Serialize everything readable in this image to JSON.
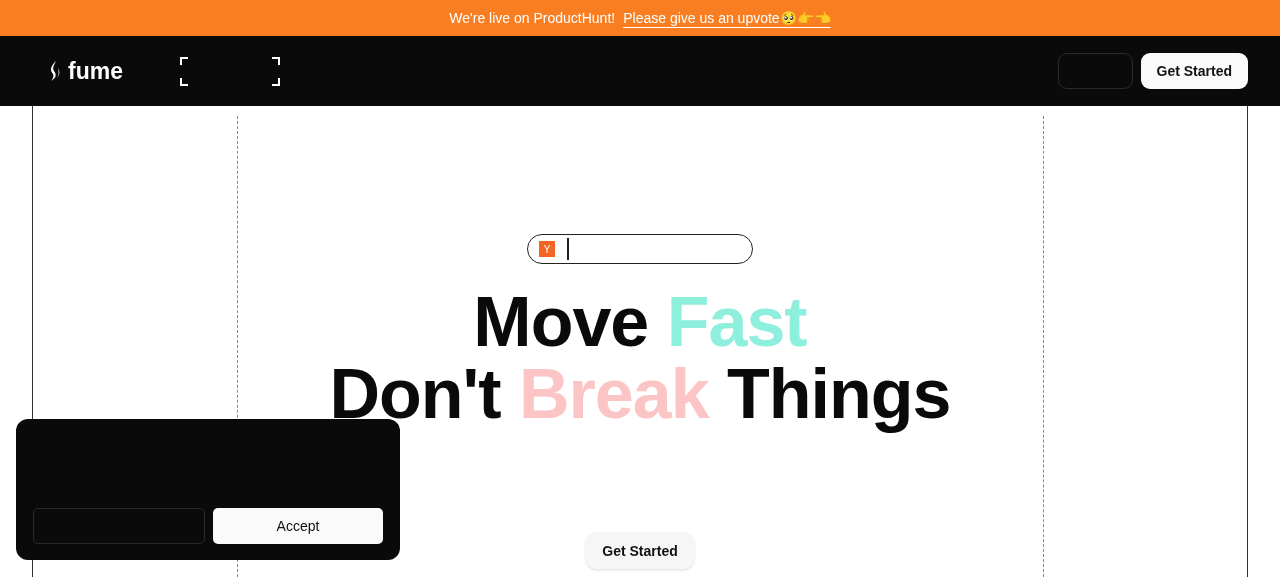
{
  "banner": {
    "text": "We're live on ProductHunt!",
    "link": "Please give us an upvote🥺👉👈"
  },
  "nav": {
    "logo": "fume",
    "cta": "Get Started"
  },
  "hero": {
    "badge_letter": "Y",
    "headline": [
      {
        "segments": [
          {
            "text": "Move ",
            "color": "#0a0a0a"
          },
          {
            "text": "Fast",
            "color": "#8ef0dc"
          }
        ]
      },
      {
        "segments": [
          {
            "text": "Don't ",
            "color": "#0a0a0a"
          },
          {
            "text": "Break",
            "color": "#fcc5c5"
          },
          {
            "text": " Things",
            "color": "#0a0a0a"
          }
        ]
      }
    ],
    "cta": "Get Started"
  },
  "cookie": {
    "accept": "Accept"
  }
}
